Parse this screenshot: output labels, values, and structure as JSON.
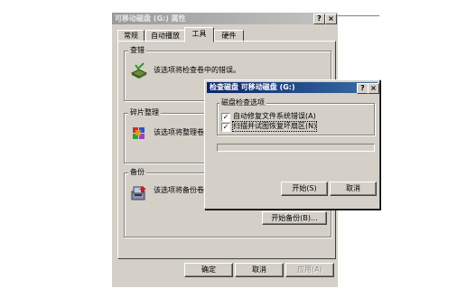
{
  "properties_dialog": {
    "title": "可移动磁盘 (G:) 属性",
    "help_button": "?",
    "close_button": "×",
    "tabs": [
      "常规",
      "自动播放",
      "工具",
      "硬件"
    ],
    "active_tab": "工具",
    "groups": {
      "error_check": {
        "label": "查错",
        "description": "该选项将检查卷中的错误。"
      },
      "defrag": {
        "label": "碎片整理",
        "description": "该选项将整理卷中"
      },
      "backup": {
        "label": "备份",
        "description": "该选项将备份卷",
        "button": "开始备份(B)..."
      }
    },
    "footer": {
      "ok": "确定",
      "cancel": "取消",
      "apply": "应用(A)"
    }
  },
  "check_disk_dialog": {
    "title": "检查磁盘 可移动磁盘 (G:)",
    "help_button": "?",
    "close_button": "×",
    "group_label": "磁盘检查选项",
    "options": [
      {
        "label": "自动修复文件系统错误(A)",
        "checked": true
      },
      {
        "label": "扫描并试图恢复坏扇区(N)",
        "checked": true
      }
    ],
    "progress": 0,
    "start_button": "开始(S)",
    "cancel_button": "取消"
  }
}
